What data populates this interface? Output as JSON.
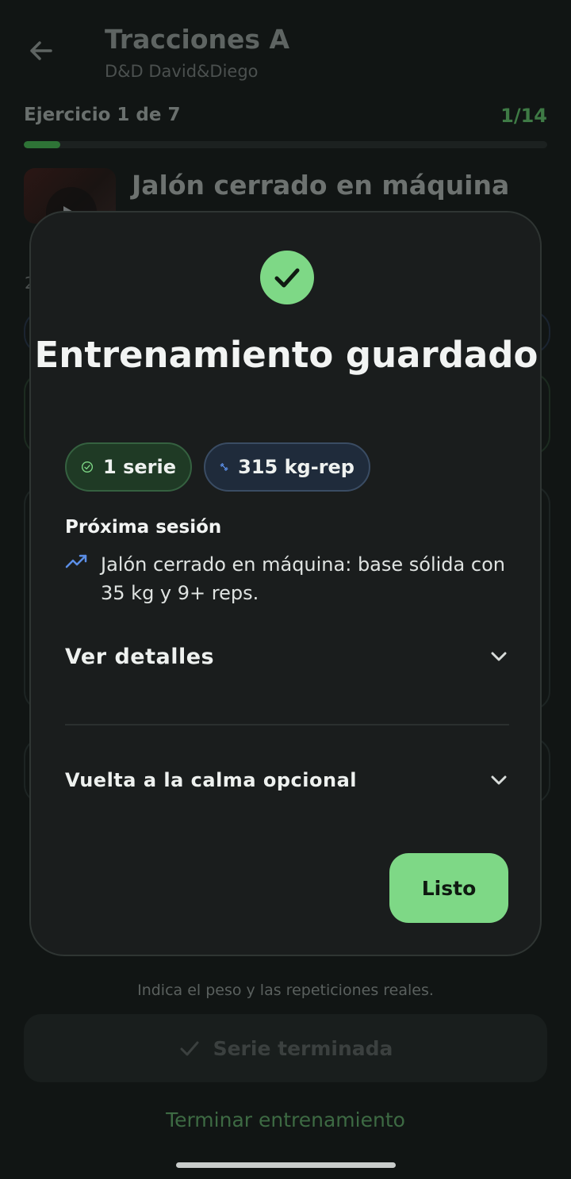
{
  "header": {
    "title": "Tracciones A",
    "subtitle": "D&D David&Diego"
  },
  "progress": {
    "exercise_label": "Ejercicio 1 de 7",
    "set_counter": "1/14",
    "fraction": 0.07
  },
  "exercise": {
    "name": "Jalón cerrado en máquina"
  },
  "background": {
    "hint": "Indica el peso y las repeticiones reales.",
    "set_done_label": "Serie terminada",
    "finish_label": "Terminar entrenamiento",
    "partial_letter": "2"
  },
  "modal": {
    "title": "Entrenamiento guardado",
    "stats": {
      "sets": "1 serie",
      "volume": "315 kg-rep"
    },
    "next_session": {
      "heading": "Próxima sesión",
      "text": "Jalón cerrado en máquina: base sólida con 35 kg y 9+ reps."
    },
    "details_label": "Ver detalles",
    "cooldown_label": "Vuelta a la calma opcional",
    "done_label": "Listo"
  },
  "colors": {
    "accent_green": "#7ed886",
    "accent_blue": "#5b8ee6",
    "background": "#111514",
    "sheet": "#1a1d1d"
  },
  "icons": {
    "back": "arrow-left-icon",
    "success": "check-circle-icon",
    "sets": "check-circle-outline-icon",
    "volume": "dumbbell-icon",
    "trend": "trending-up-icon",
    "expand": "chevron-down-icon",
    "set_done": "check-icon"
  }
}
